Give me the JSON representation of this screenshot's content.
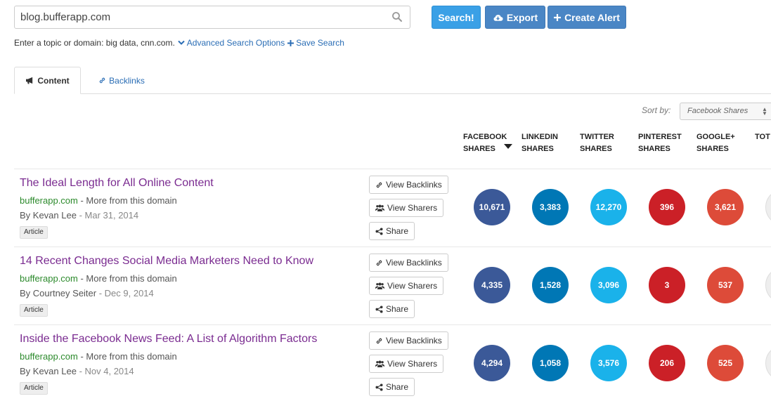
{
  "search": {
    "value": "blog.bufferapp.com",
    "buttons": {
      "search": "Search!",
      "export": "Export",
      "create_alert": "Create Alert"
    },
    "hint": "Enter a topic or domain: big data, cnn.com.",
    "advanced": "Advanced Search Options",
    "save": "Save Search"
  },
  "tabs": [
    {
      "label": "Content"
    },
    {
      "label": "Backlinks"
    }
  ],
  "sort": {
    "label": "Sort by:",
    "selected": "Facebook Shares"
  },
  "columns": [
    {
      "line1": "FACEBOOK",
      "line2": "SHARES"
    },
    {
      "line1": "LINKEDIN",
      "line2": "SHARES"
    },
    {
      "line1": "TWITTER",
      "line2": "SHARES"
    },
    {
      "line1": "PINTEREST",
      "line2": "SHARES"
    },
    {
      "line1": "GOOGLE+",
      "line2": "SHARES"
    },
    {
      "line1": "TOT",
      "line2": ""
    }
  ],
  "actions": {
    "backlinks": "View Backlinks",
    "sharers": "View Sharers",
    "share": "Share"
  },
  "colors": {
    "facebook": "#3b5998",
    "linkedin": "#0077b5",
    "twitter": "#1ab2ea",
    "pinterest": "#cb2027",
    "google": "#dd4b39"
  },
  "articles": [
    {
      "title": "The Ideal Length for All Online Content",
      "domain": "bufferapp.com",
      "more": " - More from this domain",
      "by": "By Kevan Lee",
      "date": " - Mar 31, 2014",
      "type": "Article",
      "facebook": "10,671",
      "linkedin": "3,383",
      "twitter": "12,270",
      "pinterest": "396",
      "google": "3,621"
    },
    {
      "title": "14 Recent Changes Social Media Marketers Need to Know",
      "domain": "bufferapp.com",
      "more": " - More from this domain",
      "by": "By Courtney Seiter",
      "date": " - Dec 9, 2014",
      "type": "Article",
      "facebook": "4,335",
      "linkedin": "1,528",
      "twitter": "3,096",
      "pinterest": "3",
      "google": "537"
    },
    {
      "title": "Inside the Facebook News Feed: A List of Algorithm Factors",
      "domain": "bufferapp.com",
      "more": " - More from this domain",
      "by": "By Kevan Lee",
      "date": " - Nov 4, 2014",
      "type": "Article",
      "facebook": "4,294",
      "linkedin": "1,058",
      "twitter": "3,576",
      "pinterest": "206",
      "google": "525"
    }
  ]
}
